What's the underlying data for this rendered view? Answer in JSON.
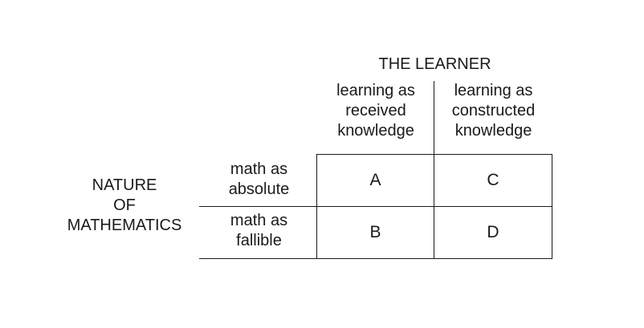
{
  "column_group_label": "THE LEARNER",
  "columns": [
    {
      "lines": [
        "learning as",
        "received",
        "knowledge"
      ]
    },
    {
      "lines": [
        "learning as",
        "constructed",
        "knowledge"
      ]
    }
  ],
  "row_group_label": [
    "NATURE",
    "OF",
    "MATHEMATICS"
  ],
  "rows": [
    {
      "lines": [
        "math as",
        "absolute"
      ]
    },
    {
      "lines": [
        "math as",
        "fallible"
      ]
    }
  ],
  "cells": [
    [
      "A",
      "C"
    ],
    [
      "B",
      "D"
    ]
  ]
}
